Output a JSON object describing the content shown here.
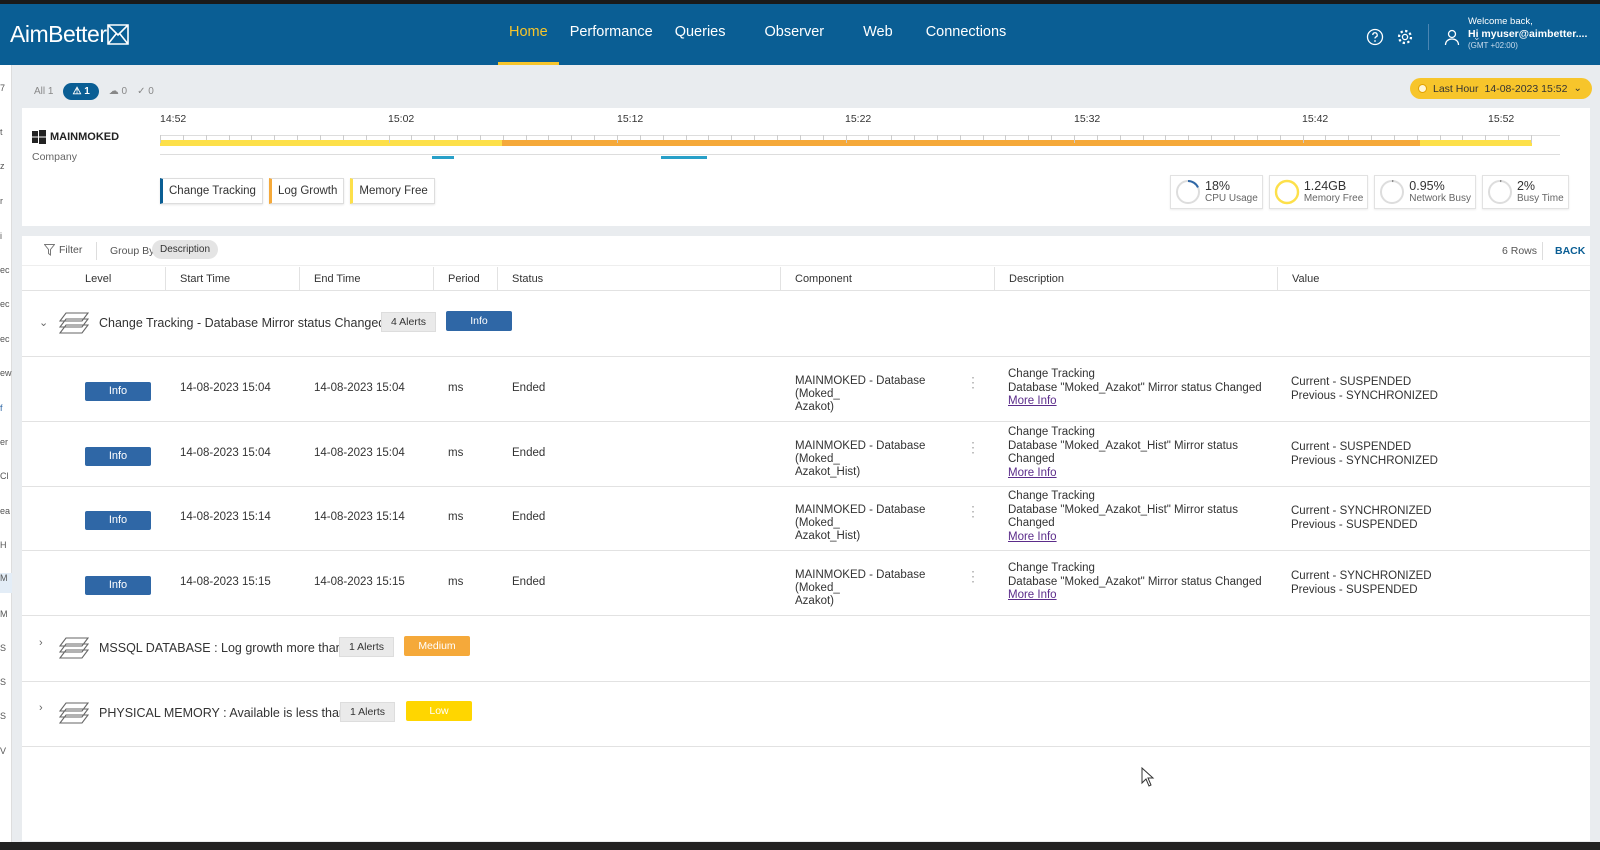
{
  "app": {
    "brand": "AimBetter"
  },
  "nav": {
    "items": [
      {
        "label": "Home",
        "active": true
      },
      {
        "label": "Performance"
      },
      {
        "label": "Queries"
      },
      {
        "label": "Observer"
      },
      {
        "label": "Web"
      },
      {
        "label": "Connections"
      }
    ]
  },
  "user": {
    "welcome": "Welcome back,",
    "name": "Hi myuser@aimbetter....",
    "timezone": "(GMT +02:00)"
  },
  "alert_filters": {
    "all": "All 1",
    "warnings": "1",
    "cloud": "0",
    "checks": "0"
  },
  "time_range": {
    "label": "Last Hour",
    "value": "14-08-2023 15:52"
  },
  "server": {
    "name": "MAINMOKED",
    "company": "Company"
  },
  "timeline": {
    "labels": [
      "14:52",
      "15:02",
      "15:12",
      "15:22",
      "15:32",
      "15:42",
      "15:52"
    ]
  },
  "tags": [
    "Change Tracking",
    "Log Growth",
    "Memory Free"
  ],
  "metrics": [
    {
      "value": "18%",
      "label": "CPU Usage",
      "level": 0.18,
      "color": "#2f67a6"
    },
    {
      "value": "1.24GB",
      "label": "Memory Free",
      "level": 1.0,
      "color": "#fde04a"
    },
    {
      "value": "0.95%",
      "label": "Network Busy",
      "level": 0.0095,
      "color": "#888888"
    },
    {
      "value": "2%",
      "label": "Busy Time",
      "level": 0.02,
      "color": "#888888"
    }
  ],
  "table": {
    "filter_label": "Filter",
    "group_by_label": "Group By",
    "group_by_value": "Description",
    "rows_count": "6 Rows",
    "back_label": "BACK",
    "columns": [
      "Level",
      "Start Time",
      "End Time",
      "Period",
      "Status",
      "Component",
      "Description",
      "Value"
    ],
    "groups": [
      {
        "title": "Change Tracking - Database Mirror status Changed",
        "alerts": "4 Alerts",
        "severity": "Info",
        "expanded": true,
        "rows": [
          {
            "level": "Info",
            "start": "14-08-2023 15:04",
            "end": "14-08-2023 15:04",
            "period": "ms",
            "status": "Ended",
            "component": [
              "MAINMOKED - Database (Moked_",
              "Azakot)"
            ],
            "description": [
              "Change Tracking",
              "Database \"Moked_Azakot\" Mirror status Changed"
            ],
            "more": "More Info",
            "value": [
              "Current - SUSPENDED",
              "Previous - SYNCHRONIZED"
            ]
          },
          {
            "level": "Info",
            "start": "14-08-2023 15:04",
            "end": "14-08-2023 15:04",
            "period": "ms",
            "status": "Ended",
            "component": [
              "MAINMOKED - Database (Moked_",
              "Azakot_Hist)"
            ],
            "description": [
              "Change Tracking",
              "Database \"Moked_Azakot_Hist\" Mirror status",
              "Changed"
            ],
            "more": "More Info",
            "value": [
              "Current - SUSPENDED",
              "Previous - SYNCHRONIZED"
            ]
          },
          {
            "level": "Info",
            "start": "14-08-2023 15:14",
            "end": "14-08-2023 15:14",
            "period": "ms",
            "status": "Ended",
            "component": [
              "MAINMOKED - Database (Moked_",
              "Azakot_Hist)"
            ],
            "description": [
              "Change Tracking",
              "Database \"Moked_Azakot_Hist\" Mirror status",
              "Changed"
            ],
            "more": "More Info",
            "value": [
              "Current - SYNCHRONIZED",
              "Previous - SUSPENDED"
            ]
          },
          {
            "level": "Info",
            "start": "14-08-2023 15:15",
            "end": "14-08-2023 15:15",
            "period": "ms",
            "status": "Ended",
            "component": [
              "MAINMOKED - Database (Moked_",
              "Azakot)"
            ],
            "description": [
              "Change Tracking",
              "Database \"Moked_Azakot\" Mirror status Changed"
            ],
            "more": "More Info",
            "value": [
              "Current - SYNCHRONIZED",
              "Previous - SUSPENDED"
            ]
          }
        ]
      },
      {
        "title": "MSSQL DATABASE : Log growth more than",
        "alerts": "1 Alerts",
        "severity": "Medium",
        "expanded": false
      },
      {
        "title": "PHYSICAL MEMORY : Available is less than",
        "alerts": "1 Alerts",
        "severity": "Low",
        "expanded": false
      }
    ]
  },
  "colors": {
    "header": "#0a5e94",
    "accent": "#f7c52b",
    "info": "#2f67a6",
    "medium": "#f5a93a",
    "low": "#ffd600"
  }
}
